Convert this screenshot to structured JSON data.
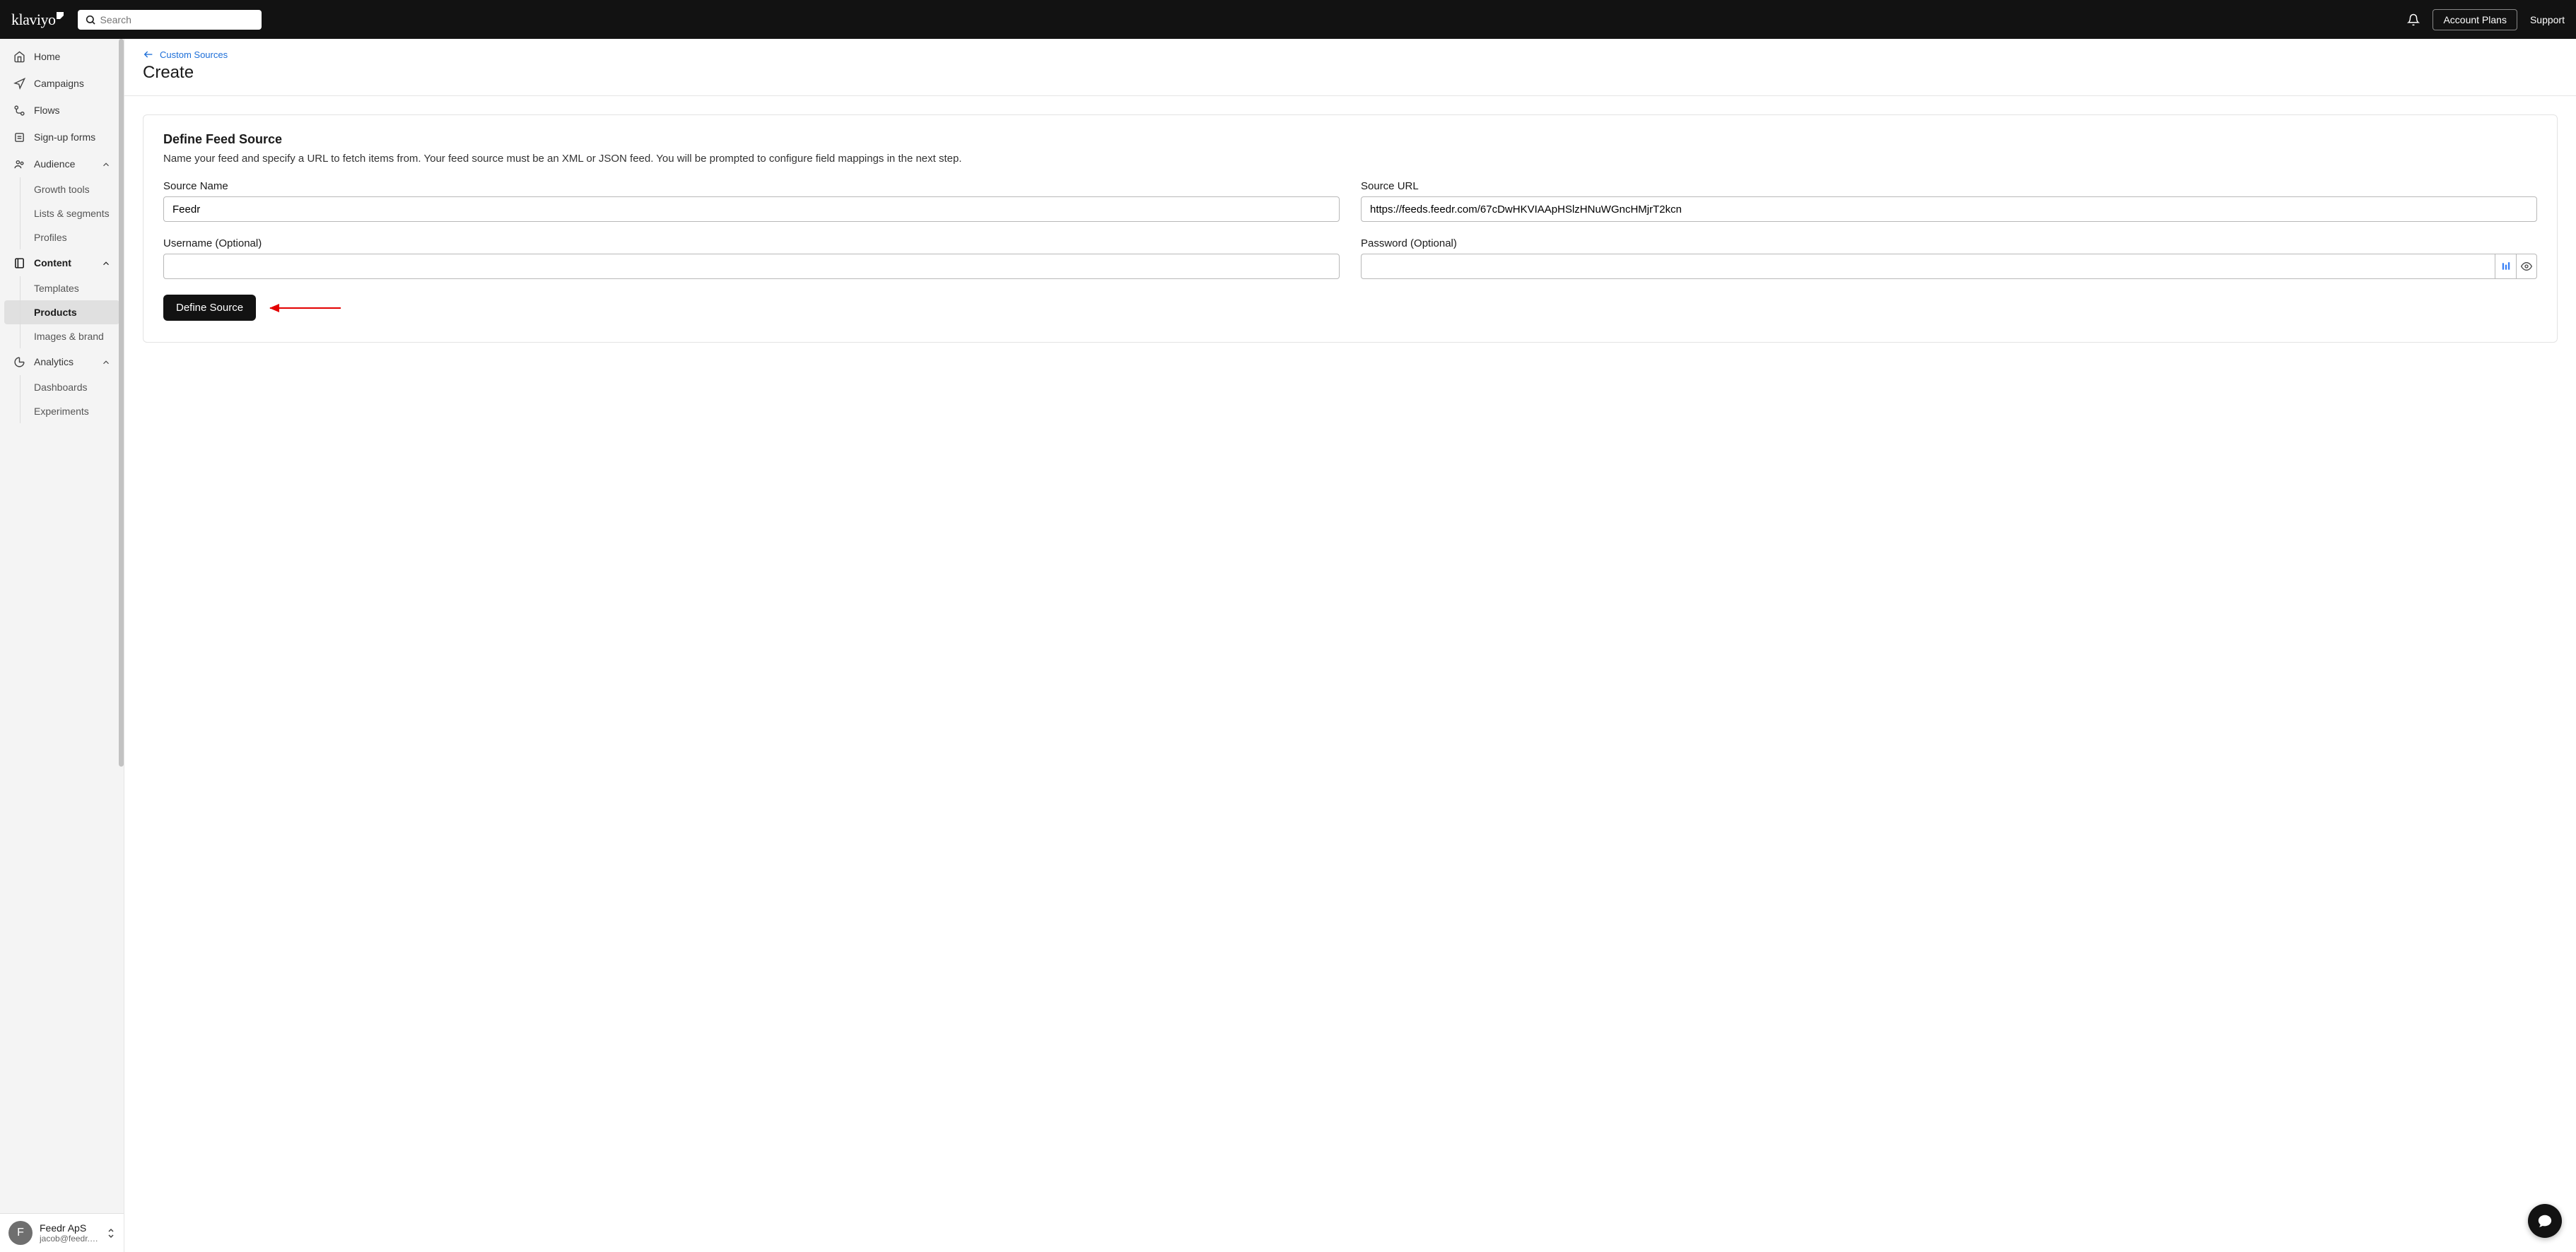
{
  "header": {
    "logo_text": "klaviyo",
    "search_placeholder": "Search",
    "account_plans": "Account Plans",
    "support": "Support"
  },
  "sidebar": {
    "items": {
      "home": "Home",
      "campaigns": "Campaigns",
      "flows": "Flows",
      "signup_forms": "Sign-up forms",
      "audience": "Audience",
      "growth_tools": "Growth tools",
      "lists_segments": "Lists & segments",
      "profiles": "Profiles",
      "content": "Content",
      "templates": "Templates",
      "products": "Products",
      "images_brand": "Images & brand",
      "analytics": "Analytics",
      "dashboards": "Dashboards",
      "experiments": "Experiments"
    },
    "footer": {
      "avatar_letter": "F",
      "account_name": "Feedr ApS",
      "account_email": "jacob@feedr.c..."
    }
  },
  "page": {
    "breadcrumb": "Custom Sources",
    "title": "Create"
  },
  "card": {
    "title": "Define Feed Source",
    "description": "Name your feed and specify a URL to fetch items from. Your feed source must be an XML or JSON feed. You will be prompted to configure field mappings in the next step.",
    "labels": {
      "source_name": "Source Name",
      "source_url": "Source URL",
      "username": "Username (Optional)",
      "password": "Password (Optional)"
    },
    "values": {
      "source_name": "Feedr",
      "source_url": "https://feeds.feedr.com/67cDwHKVIAApHSlzHNuWGncHMjrT2kcn",
      "username": "",
      "password": ""
    },
    "submit": "Define Source"
  }
}
